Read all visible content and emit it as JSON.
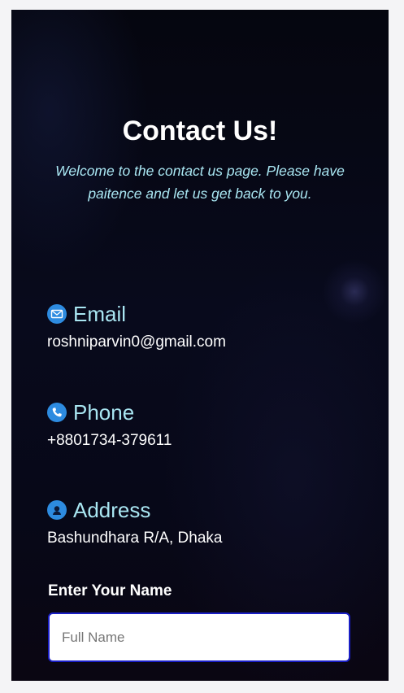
{
  "header": {
    "title": "Contact Us!",
    "subtitle": "Welcome to the contact us page. Please have paitence and let us get back to you."
  },
  "contacts": [
    {
      "label": "Email",
      "value": "roshniparvin0@gmail.com",
      "icon": "envelope-icon"
    },
    {
      "label": "Phone",
      "value": "+8801734-379611",
      "icon": "phone-icon"
    },
    {
      "label": "Address",
      "value": "Bashundhara R/A, Dhaka",
      "icon": "person-pin-icon"
    }
  ],
  "form": {
    "name_label": "Enter Your Name",
    "name_placeholder": "Full Name"
  },
  "colors": {
    "accent_text": "#a9e6f2",
    "icon_bg": "#2d8be0",
    "input_border": "#1a1fc6"
  }
}
